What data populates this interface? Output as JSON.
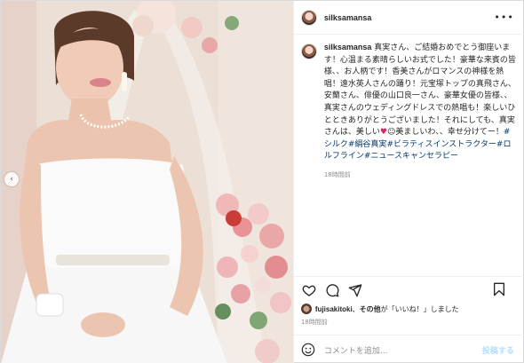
{
  "post": {
    "username": "silksamansa",
    "caption": "真実さん、ご結婚おめでとう御座います！心温まる素晴らしいお式でした！豪華な来賓の皆様、、お人柄です！香美さんがロマンスの神様を熱唱！遠水英人さんの踊り！元宝塚トップの真飛さん、安蘭さん、俳優の山口良一さん、豪華女優の皆様、、真実さんのウェディングドレスでの熱唱も！楽しいひとときありがとうございました！それにしても、真実さんは、美しい",
    "caption_tail": "美ましいわ、、幸せ分けてー！",
    "hashtags": [
      "#シルク",
      "#絹谷真実",
      "#ビラティスインストラクター",
      "#ロルフライン",
      "#ニュースキャンセラピー"
    ],
    "time": "18時間前"
  },
  "likes": {
    "user": "fujisakitoki",
    "text_connector": "、",
    "other": "その他",
    "suffix": "が「いいね！」しました",
    "time": "18時間前"
  },
  "comment": {
    "placeholder": "コメントを追加...",
    "post_label": "投稿する"
  },
  "icons": {
    "more": "more-horizontal-icon",
    "heart": "heart-icon",
    "comment": "comment-icon",
    "share": "share-icon",
    "save": "bookmark-icon",
    "emoji": "emoji-icon",
    "prev": "chevron-left-icon"
  },
  "colors": {
    "hashtag": "#00376b",
    "muted": "#8e8e8e",
    "post_button": "#b2dffc"
  }
}
